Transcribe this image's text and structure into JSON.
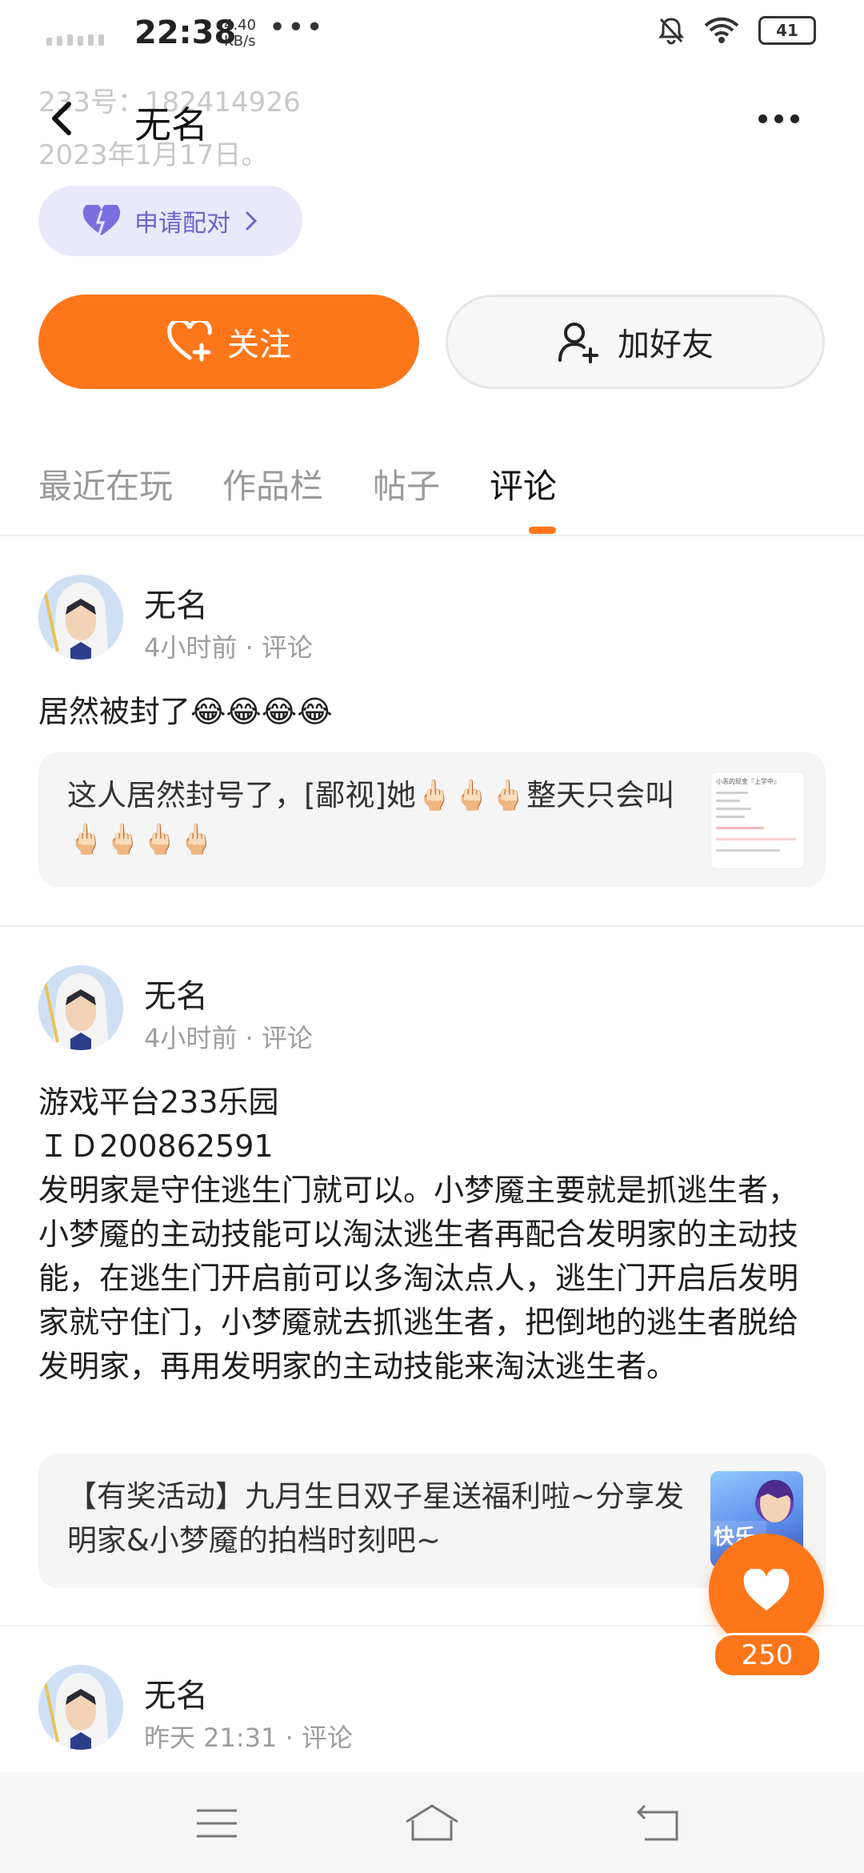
{
  "status_bar": {
    "time": "22:38",
    "speed_value": "4.40",
    "speed_unit": "KB/s",
    "more": "•••",
    "battery": "41"
  },
  "background_profile": {
    "id_line": "233号：182414926",
    "date_line": "2023年1月17日。"
  },
  "header": {
    "title": "无名"
  },
  "pair_button": {
    "label": "申请配对"
  },
  "follow_button": {
    "label": "关注"
  },
  "add_friend_button": {
    "label": "加好友"
  },
  "tabs": [
    {
      "label": "最近在玩"
    },
    {
      "label": "作品栏"
    },
    {
      "label": "帖子"
    },
    {
      "label": "评论"
    }
  ],
  "posts": [
    {
      "username": "无名",
      "time": "4小时前",
      "type": "评论",
      "text": "居然被封了😂😂😂😂",
      "quote": "这人居然封号了，[鄙视]她🖕🏻🖕🏻🖕🏻整天只会叫🖕🏻🖕🏻🖕🏻🖕🏻",
      "thumb_title": "小恶的现金『上学中』"
    },
    {
      "username": "无名",
      "time": "4小时前",
      "type": "评论",
      "text_lines": [
        "游戏平台233乐园",
        "ＩＤ200862591",
        "发明家是守住逃生门就可以。小梦魇主要就是抓逃生者，小梦魇的主动技能可以淘汰逃生者再配合发明家的主动技能，在逃生门开启前可以多淘汰点人，逃生门开启后发明家就守住门，小梦魇就去抓逃生者，把倒地的逃生者脱给发明家，再用发明家的主动技能来淘汰逃生者。"
      ],
      "quote": "【有奖活动】九月生日双子星送福利啦~分享发明家&小梦魇的拍档时刻吧~",
      "thumb_text": "快乐"
    },
    {
      "username": "无名",
      "time": "昨天 21:31",
      "type": "评论"
    }
  ],
  "like": {
    "count": "250"
  },
  "colors": {
    "accent": "#fd7619",
    "pair": "#6d63c7"
  }
}
